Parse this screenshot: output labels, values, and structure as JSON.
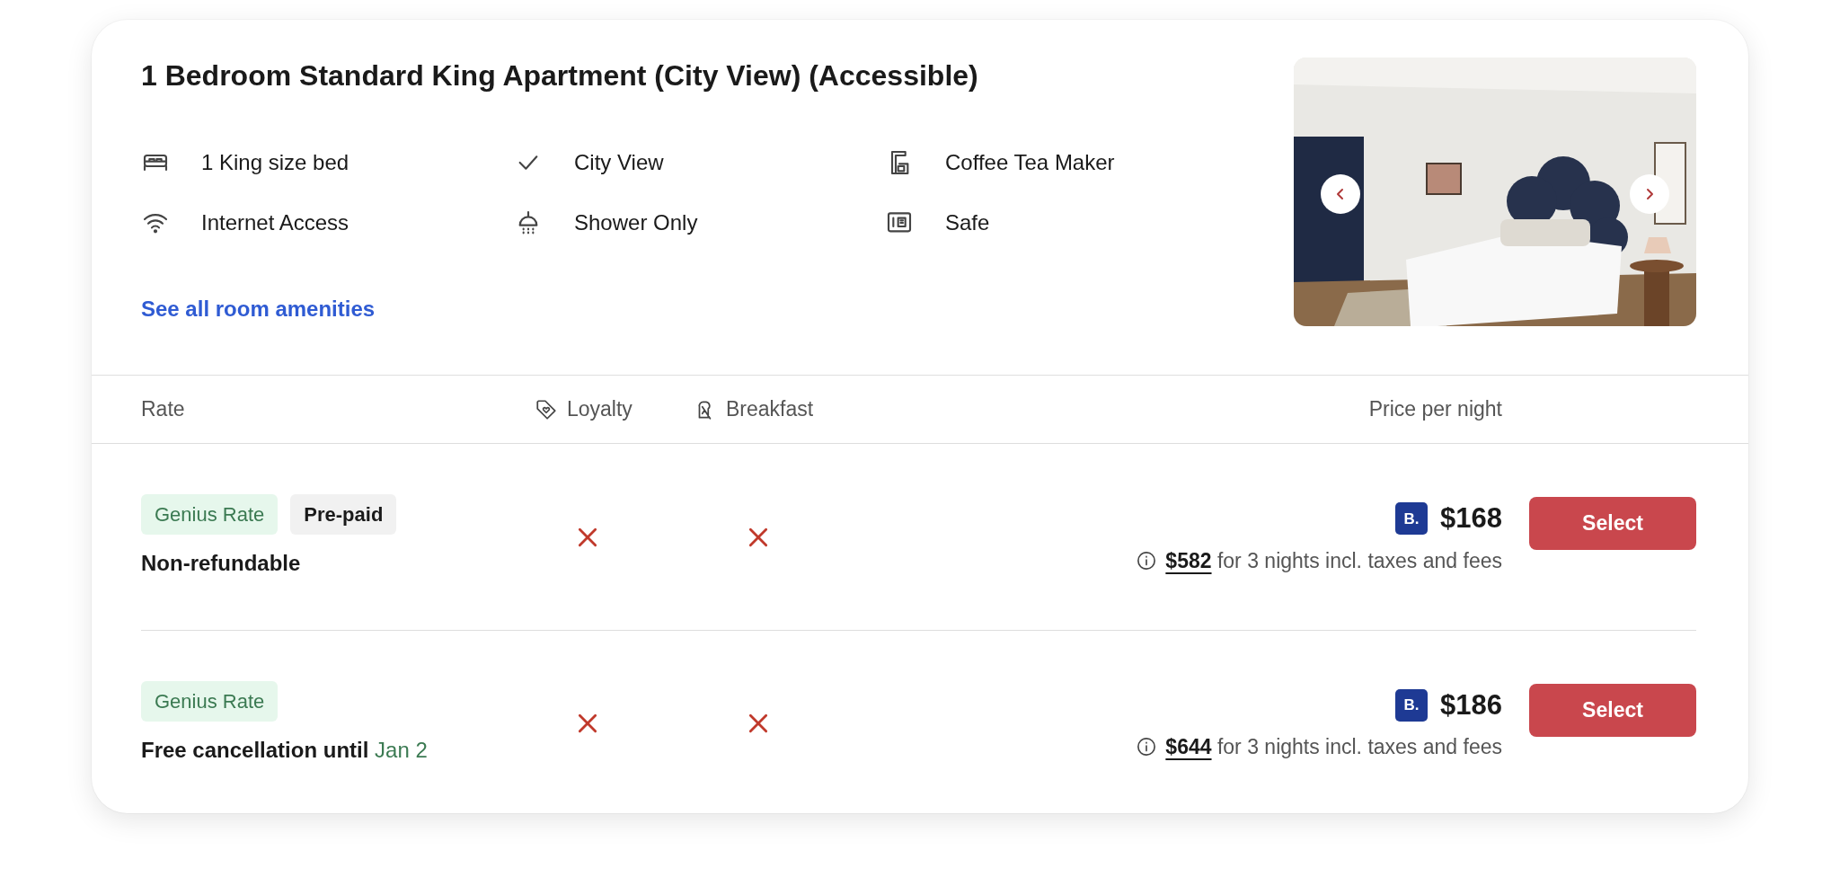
{
  "room": {
    "title": "1 Bedroom Standard King Apartment (City View) (Accessible)",
    "amenities": [
      {
        "label": "1 King size bed"
      },
      {
        "label": "City View"
      },
      {
        "label": "Coffee Tea Maker"
      },
      {
        "label": "Internet Access"
      },
      {
        "label": "Shower Only"
      },
      {
        "label": "Safe"
      }
    ],
    "amenities_link": "See all room amenities"
  },
  "rates_table": {
    "columns": [
      {
        "label": "Rate"
      },
      {
        "label": "Loyalty"
      },
      {
        "label": "Breakfast"
      },
      {
        "label": "Price per night"
      }
    ],
    "rows": [
      {
        "tags": [
          {
            "label": "Genius Rate",
            "kind": "genius"
          },
          {
            "label": "Pre-paid",
            "kind": "plain"
          }
        ],
        "policy": "Non-refundable",
        "loyalty": false,
        "breakfast": false,
        "brand_badge": "B.",
        "price": "$168",
        "total": "$582",
        "total_note": "for 3 nights incl. taxes and fees",
        "button": "Select"
      },
      {
        "tags": [
          {
            "label": "Genius Rate",
            "kind": "genius"
          }
        ],
        "policy": "Free cancellation until",
        "policy_date": "Jan 2",
        "loyalty": false,
        "breakfast": false,
        "brand_badge": "B.",
        "price": "$186",
        "total": "$644",
        "total_note": "for 3 nights incl. taxes and fees",
        "button": "Select"
      }
    ]
  }
}
